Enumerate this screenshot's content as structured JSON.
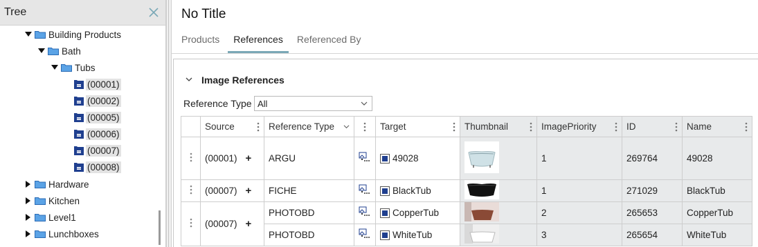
{
  "tree": {
    "title": "Tree",
    "nodes": [
      {
        "label": "Building Products"
      },
      {
        "label": "Bath"
      },
      {
        "label": "Tubs"
      },
      {
        "label": "(00001)"
      },
      {
        "label": "(00002)"
      },
      {
        "label": "(00005)"
      },
      {
        "label": "(00006)"
      },
      {
        "label": "(00007)"
      },
      {
        "label": "(00008)"
      },
      {
        "label": "Hardware"
      },
      {
        "label": "Kitchen"
      },
      {
        "label": "Level1"
      },
      {
        "label": "Lunchboxes"
      }
    ]
  },
  "page": {
    "title": "No Title"
  },
  "tabs": [
    {
      "label": "Products"
    },
    {
      "label": "References"
    },
    {
      "label": "Referenced By"
    }
  ],
  "section": {
    "title": "Image References",
    "filter_label": "Reference Type",
    "filter_value": "All"
  },
  "table": {
    "headers": [
      "Source",
      "Reference Type",
      "Target",
      "Thumbnail",
      "ImagePriority",
      "ID",
      "Name"
    ],
    "rows": [
      {
        "source": "(00001)",
        "ref_type": "ARGU",
        "target": "49028",
        "priority": "1",
        "id": "269764",
        "name": "49028"
      },
      {
        "source": "(00007)",
        "ref_type": "FICHE",
        "target": "BlackTub",
        "priority": "1",
        "id": "271029",
        "name": "BlackTub"
      },
      {
        "source": "(00007)",
        "ref_type": "PHOTOBD",
        "target": "CopperTub",
        "priority": "2",
        "id": "265653",
        "name": "CopperTub"
      },
      {
        "source": "",
        "ref_type": "PHOTOBD",
        "target": "WhiteTub",
        "priority": "3",
        "id": "265654",
        "name": "WhiteTub"
      }
    ]
  },
  "colors": {
    "accent": "#7aa8b6",
    "folder": "#4a90d9",
    "item": "#1f3f8f"
  }
}
